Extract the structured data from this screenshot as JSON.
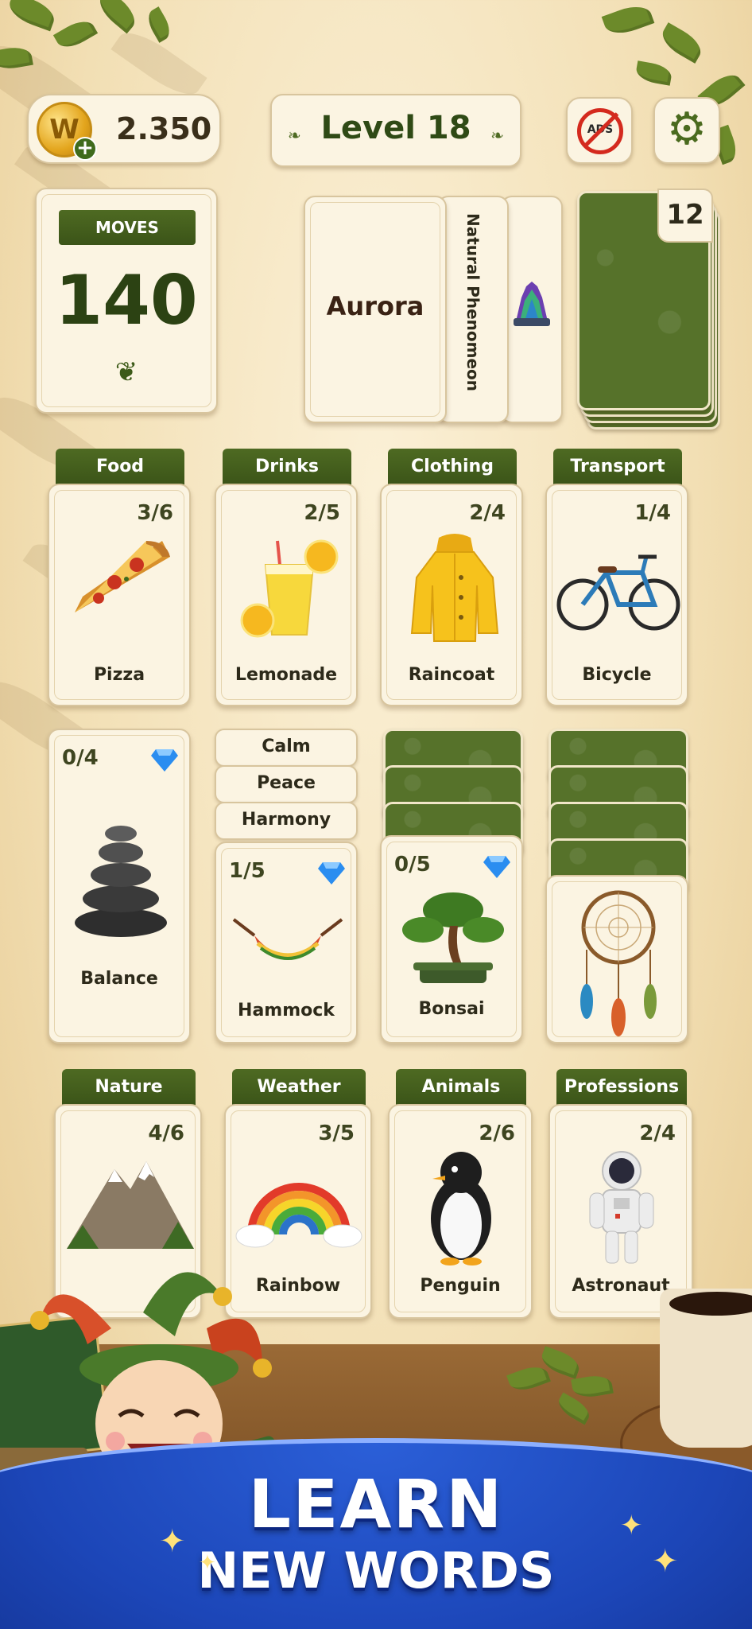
{
  "header": {
    "coins": "2.350",
    "level": "Level 18",
    "ads_label": "ADS"
  },
  "moves": {
    "label": "MOVES",
    "value": "140"
  },
  "current_card": {
    "word": "Aurora",
    "category": "Natural Phenomeon"
  },
  "deck": {
    "count": "12"
  },
  "row1": [
    {
      "category": "Food",
      "count": "3/6",
      "word": "Pizza"
    },
    {
      "category": "Drinks",
      "count": "2/5",
      "word": "Lemonade"
    },
    {
      "category": "Clothing",
      "count": "2/4",
      "word": "Raincoat"
    },
    {
      "category": "Transport",
      "count": "1/4",
      "word": "Bicycle"
    }
  ],
  "row2": {
    "balance": {
      "count": "0/4",
      "word": "Balance"
    },
    "stack_words": [
      "Calm",
      "Peace",
      "Harmony"
    ],
    "hammock": {
      "count": "1/5",
      "word": "Hammock"
    },
    "bonsai": {
      "count": "0/5",
      "word": "Bonsai"
    }
  },
  "row3": [
    {
      "category": "Nature",
      "count": "4/6",
      "word": ""
    },
    {
      "category": "Weather",
      "count": "3/5",
      "word": "Rainbow"
    },
    {
      "category": "Animals",
      "count": "2/6",
      "word": "Penguin"
    },
    {
      "category": "Professions",
      "count": "2/4",
      "word": "Astronaut"
    }
  ],
  "banner": {
    "line1": "LEARN",
    "line2": "NEW WORDS"
  },
  "colors": {
    "accent": "#4e6a22",
    "banner_blue": "#1c46b8",
    "gem_blue": "#2a8df0"
  }
}
